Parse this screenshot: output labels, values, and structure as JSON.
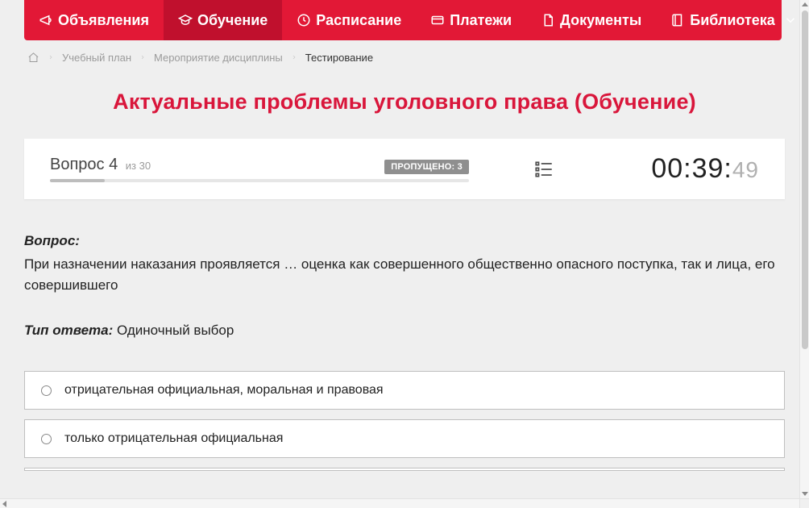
{
  "nav": {
    "items": [
      {
        "label": "Объявления",
        "icon": "megaphone-icon",
        "active": false,
        "hasChevron": false
      },
      {
        "label": "Обучение",
        "icon": "graduation-cap-icon",
        "active": true,
        "hasChevron": false
      },
      {
        "label": "Расписание",
        "icon": "clock-icon",
        "active": false,
        "hasChevron": false
      },
      {
        "label": "Платежи",
        "icon": "credit-card-icon",
        "active": false,
        "hasChevron": false
      },
      {
        "label": "Документы",
        "icon": "document-icon",
        "active": false,
        "hasChevron": false
      },
      {
        "label": "Библиотека",
        "icon": "book-icon",
        "active": false,
        "hasChevron": true
      }
    ]
  },
  "breadcrumbs": {
    "items": [
      {
        "label": "Учебный план",
        "current": false
      },
      {
        "label": "Мероприятие дисциплины",
        "current": false
      },
      {
        "label": "Тестирование",
        "current": true
      }
    ]
  },
  "title": "Актуальные проблемы уголовного права (Обучение)",
  "status": {
    "question_word": "Вопрос",
    "question_num": "4",
    "of_word": "из",
    "total": "30",
    "skipped_label": "ПРОПУЩЕНО:",
    "skipped_count": "3",
    "progress_percent": 13
  },
  "timer": {
    "main": "00:39:",
    "ms": "49"
  },
  "question": {
    "label": "Вопрос:",
    "text": "При назначении наказания проявляется … оценка как совершенного общественно опасного поступка, так и лица, его совершившего",
    "answer_type_label": "Тип ответа:",
    "answer_type": "Одиночный выбор"
  },
  "answers": [
    {
      "text": "отрицательная официальная, моральная и правовая"
    },
    {
      "text": "только отрицательная официальная"
    }
  ]
}
